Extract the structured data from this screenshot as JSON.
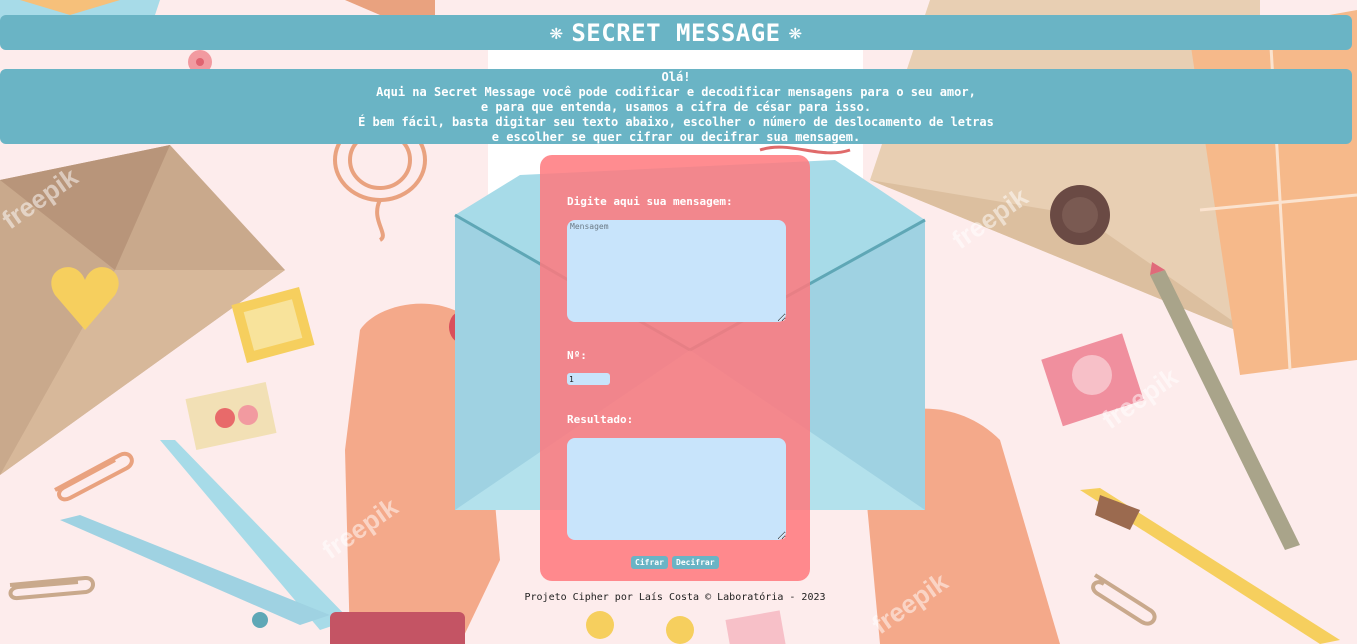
{
  "header": {
    "title": "SECRET MESSAGE",
    "left_ornament": "❋",
    "right_ornament": "❋"
  },
  "intro": {
    "lines": [
      "Olá!",
      "Aqui na Secret Message você pode codificar e decodificar mensagens para o seu amor,",
      "e para que entenda, usamos a cifra de césar para isso.",
      "É bem fácil, basta digitar seu texto abaixo, escolher o número de deslocamento de letras",
      "e escolher se quer cifrar ou decifrar sua mensagem."
    ]
  },
  "form": {
    "message_label": "Digite aqui sua mensagem:",
    "message_placeholder": "Mensagem",
    "message_value": "",
    "offset_label": "Nº:",
    "offset_value": "1",
    "result_label": "Resultado:",
    "result_value": "",
    "encrypt_label": "Cifrar",
    "decrypt_label": "Decifrar"
  },
  "footer": {
    "text": "Projeto Cipher por Laís Costa © Laboratória - 2023"
  },
  "watermark": "freepik",
  "colors": {
    "banner": "#6ab4c5",
    "card": "#ff787d",
    "input_bg": "#c8e4fb",
    "page_bg": "#fdecec"
  }
}
